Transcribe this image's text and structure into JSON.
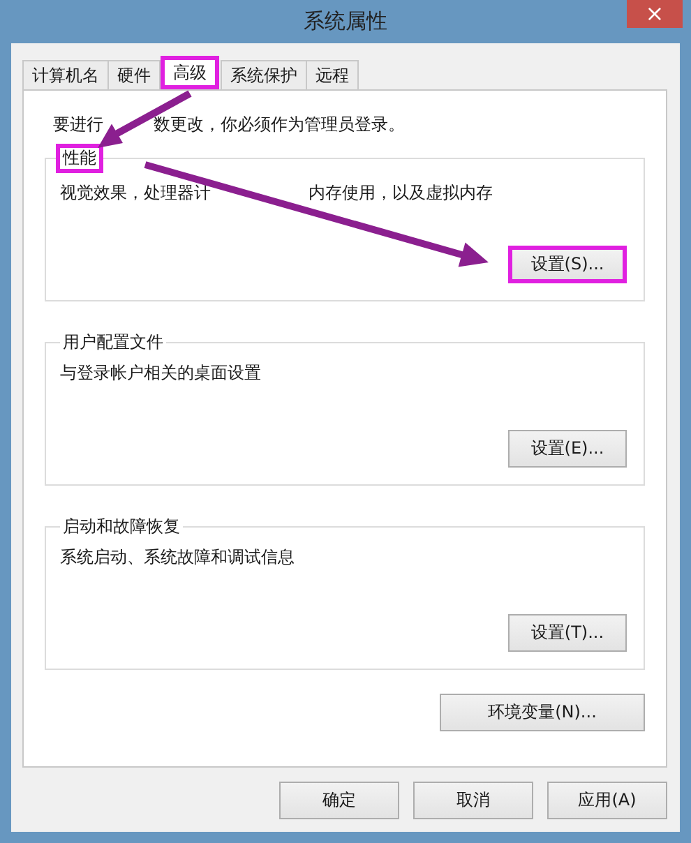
{
  "window": {
    "title": "系统属性",
    "close": "×"
  },
  "tabs": [
    {
      "label": "计算机名",
      "selected": false,
      "highlighted": false
    },
    {
      "label": "硬件",
      "selected": false,
      "highlighted": false
    },
    {
      "label": "高级",
      "selected": true,
      "highlighted": true
    },
    {
      "label": "系统保护",
      "selected": false,
      "highlighted": false
    },
    {
      "label": "远程",
      "selected": false,
      "highlighted": false
    }
  ],
  "notice": [
    "要进行",
    "数更改，你必须作为管理员登录。"
  ],
  "groups": [
    {
      "title": "性能",
      "description": [
        "视觉效果，处理器计",
        "内存使用，以及虚拟内存"
      ],
      "button": "设置(S)...",
      "highlighted": true
    },
    {
      "title": "用户配置文件",
      "description": [
        "与登录帐户相关的桌面设置"
      ],
      "button": "设置(E)...",
      "highlighted": false
    },
    {
      "title": "启动和故障恢复",
      "description": [
        "系统启动、系统故障和调试信息"
      ],
      "button": "设置(T)...",
      "highlighted": false
    }
  ],
  "env_button": "环境变量(N)...",
  "buttons": [
    "确定",
    "取消",
    "应用(A)"
  ]
}
